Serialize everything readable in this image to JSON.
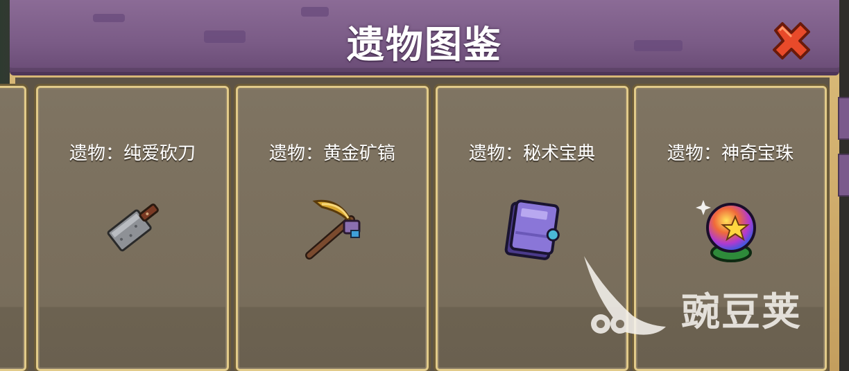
{
  "header": {
    "title": "遗物图鉴",
    "close_icon": "close-x-icon",
    "colors": {
      "header_purple": "#7a5b86",
      "close_red": "#e84a2a",
      "card_border_gold": "#e2cb8a"
    }
  },
  "relics": [
    {
      "name": "遗物：纯爱砍刀",
      "icon": "cleaver-icon"
    },
    {
      "name": "遗物：黄金矿镐",
      "icon": "pickaxe-icon"
    },
    {
      "name": "遗物：秘术宝典",
      "icon": "spellbook-icon"
    },
    {
      "name": "遗物：神奇宝珠",
      "icon": "magic-orb-icon"
    }
  ],
  "watermark": {
    "text": "豌豆荚",
    "icon": "wandoujia-logo-icon"
  }
}
